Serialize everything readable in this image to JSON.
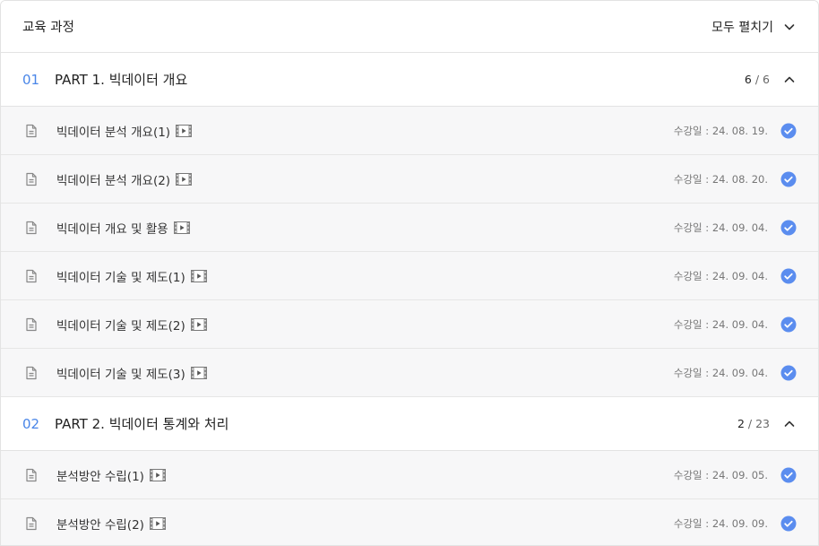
{
  "header": {
    "title": "교육 과정",
    "expand_all_label": "모두 펼치기"
  },
  "colors": {
    "accent": "#4a86e8",
    "check": "#5b8def"
  },
  "parts": [
    {
      "number": "01",
      "title": "PART 1. 빅데이터 개요",
      "done": "6",
      "total": "/ 6",
      "lessons": [
        {
          "title": "빅데이터 분석 개요(1)",
          "date": "수강일 : 24. 08. 19."
        },
        {
          "title": "빅데이터 분석 개요(2)",
          "date": "수강일 : 24. 08. 20."
        },
        {
          "title": "빅데이터 개요 및 활용",
          "date": "수강일 : 24. 09. 04."
        },
        {
          "title": "빅데이터 기술 및 제도(1)",
          "date": "수강일 : 24. 09. 04."
        },
        {
          "title": "빅데이터 기술 및 제도(2)",
          "date": "수강일 : 24. 09. 04."
        },
        {
          "title": "빅데이터 기술 및 제도(3)",
          "date": "수강일 : 24. 09. 04."
        }
      ]
    },
    {
      "number": "02",
      "title": "PART 2. 빅데이터 통계와 처리",
      "done": "2",
      "total": "/ 23",
      "lessons": [
        {
          "title": "분석방안 수립(1)",
          "date": "수강일 : 24. 09. 05."
        },
        {
          "title": "분석방안 수립(2)",
          "date": "수강일 : 24. 09. 09."
        }
      ]
    }
  ]
}
